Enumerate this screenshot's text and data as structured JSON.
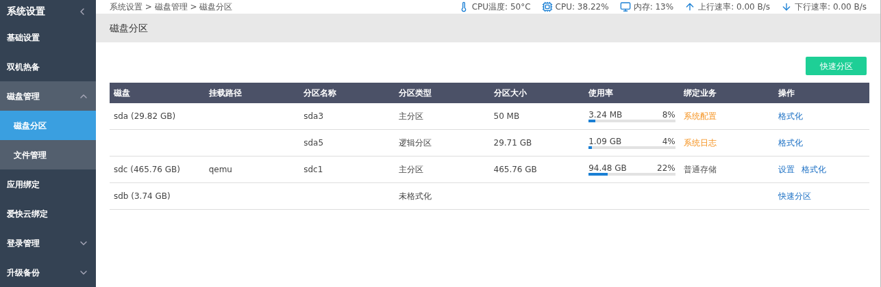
{
  "sidebar": {
    "title": "系统设置",
    "items": [
      {
        "label": "基础设置",
        "selected": false
      },
      {
        "label": "双机热备",
        "selected": false
      },
      {
        "label": "磁盘管理",
        "selected": false,
        "expanded": true,
        "children": [
          {
            "label": "磁盘分区",
            "selected": true
          },
          {
            "label": "文件管理",
            "selected": false
          }
        ]
      },
      {
        "label": "应用绑定",
        "selected": false
      },
      {
        "label": "爱快云绑定",
        "selected": false
      },
      {
        "label": "登录管理",
        "selected": false,
        "expanded": false
      },
      {
        "label": "升级备份",
        "selected": false,
        "expanded": false
      }
    ]
  },
  "breadcrumb": "系统设置 > 磁盘管理 > 磁盘分区",
  "status": [
    {
      "kind": "temperature",
      "text": "CPU温度: 50°C"
    },
    {
      "kind": "cpu",
      "text": "CPU: 38.22%"
    },
    {
      "kind": "memory",
      "text": "内存: 13%"
    },
    {
      "kind": "upload",
      "text": "上行速率: 0.00 B/s"
    },
    {
      "kind": "download",
      "text": "下行速率: 0.00 B/s"
    }
  ],
  "page_title": "磁盘分区",
  "quick_partition_button": "快速分区",
  "table": {
    "columns": [
      "磁盘",
      "挂载路径",
      "分区名称",
      "分区类型",
      "分区大小",
      "使用率",
      "绑定业务",
      "操作"
    ],
    "rows": [
      {
        "disk": "sda (29.82 GB)",
        "partition": "sda3",
        "type": "主分区",
        "size": "50 MB",
        "usage": {
          "used": "3.24 MB",
          "percent": "8%",
          "level": 0.08
        },
        "binding": {
          "text": "系统配置",
          "highlighted": true
        },
        "actions": [
          "格式化"
        ]
      },
      {
        "partition": "sda5",
        "type": "逻辑分区",
        "size": "29.71 GB",
        "usage": {
          "used": "1.09 GB",
          "percent": "4%",
          "level": 0.04
        },
        "binding": {
          "text": "系统日志",
          "highlighted": true
        },
        "actions": [
          "格式化"
        ]
      },
      {
        "disk": "sdc (465.76 GB)",
        "mount": "qemu",
        "partition": "sdc1",
        "type": "主分区",
        "size": "465.76 GB",
        "usage": {
          "used": "94.48 GB",
          "percent": "22%",
          "level": 0.22
        },
        "binding": {
          "text": "普通存储",
          "highlighted": false
        },
        "actions": [
          "设置",
          "格式化"
        ]
      },
      {
        "disk": "sdb (3.74 GB)",
        "type": "未格式化",
        "actions": [
          "快速分区"
        ]
      }
    ]
  }
}
